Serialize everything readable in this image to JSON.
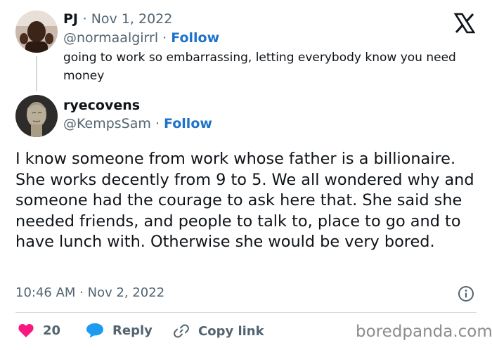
{
  "colors": {
    "text": "#0f1419",
    "secondary": "#536471",
    "follow": "#1d72c9",
    "like": "#f91880",
    "reply": "#1d9bf0",
    "divider": "#cfd9de",
    "watermark": "#8c8c8c"
  },
  "parent_tweet": {
    "name": "PJ",
    "date": "· Nov 1, 2022",
    "handle": "@normaalgirrl",
    "separator": "·",
    "follow_label": "Follow",
    "text": "going to work so embarrassing, letting everybody know you need money",
    "avatar_icon": "person-avatar"
  },
  "reply_tweet": {
    "name": "ryecovens",
    "handle": "@KempsSam",
    "separator": "·",
    "follow_label": "Follow",
    "avatar_icon": "caesar-bust-avatar",
    "text": "I know someone from work whose father is a billionaire. She works decently from 9 to 5. We all wondered why and someone had the courage to ask here that. She said she needed friends, and people to talk to, place to go and to have lunch with. Otherwise she would be very bored.",
    "timestamp": "10:46 AM · Nov 2, 2022"
  },
  "actions": {
    "like_count": "20",
    "reply_label": "Reply",
    "copy_label": "Copy link"
  },
  "icons": {
    "platform": "x-logo-icon",
    "info": "info-icon",
    "like": "heart-icon",
    "reply": "speech-bubble-icon",
    "copy": "link-icon"
  },
  "watermark": "boredpanda.com"
}
